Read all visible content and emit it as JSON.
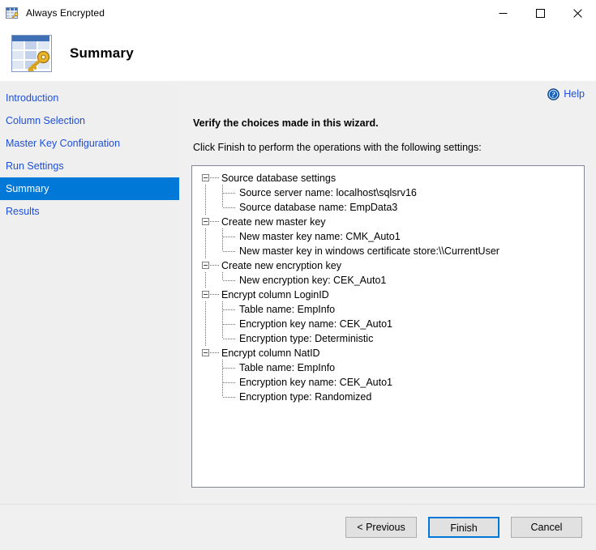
{
  "window": {
    "title": "Always Encrypted",
    "app_icon": "always-encrypted-icon",
    "minimize": "–",
    "maximize": "□",
    "close": "✕"
  },
  "header": {
    "title": "Summary",
    "icon": "table-key-icon"
  },
  "sidebar": {
    "items": [
      {
        "label": "Introduction",
        "selected": false
      },
      {
        "label": "Column Selection",
        "selected": false
      },
      {
        "label": "Master Key Configuration",
        "selected": false
      },
      {
        "label": "Run Settings",
        "selected": false
      },
      {
        "label": "Summary",
        "selected": true
      },
      {
        "label": "Results",
        "selected": false
      }
    ],
    "selected_background": "#0078d7",
    "link_color": "#1f4fd8"
  },
  "content": {
    "help_label": "Help",
    "help_icon": "help-circle-icon",
    "verify_text": "Verify the choices made in this wizard.",
    "instruction_text": "Click Finish to perform the operations with the following settings:"
  },
  "tree": {
    "nodes": [
      {
        "label": "Source database settings",
        "children": [
          "Source server name: localhost\\sqlsrv16",
          "Source database name: EmpData3"
        ]
      },
      {
        "label": "Create new master key",
        "children": [
          "New master key name: CMK_Auto1",
          "New master key in windows certificate store:\\\\CurrentUser"
        ]
      },
      {
        "label": "Create new encryption key",
        "children": [
          "New encryption key: CEK_Auto1"
        ]
      },
      {
        "label": "Encrypt column LoginID",
        "children": [
          "Table name: EmpInfo",
          "Encryption key name: CEK_Auto1",
          "Encryption type: Deterministic"
        ]
      },
      {
        "label": "Encrypt column NatID",
        "children": [
          "Table name: EmpInfo",
          "Encryption key name: CEK_Auto1",
          "Encryption type: Randomized"
        ]
      }
    ]
  },
  "footer": {
    "previous_label": "< Previous",
    "finish_label": "Finish",
    "cancel_label": "Cancel",
    "default_button": "Finish",
    "focus_color": "#0078d7"
  }
}
